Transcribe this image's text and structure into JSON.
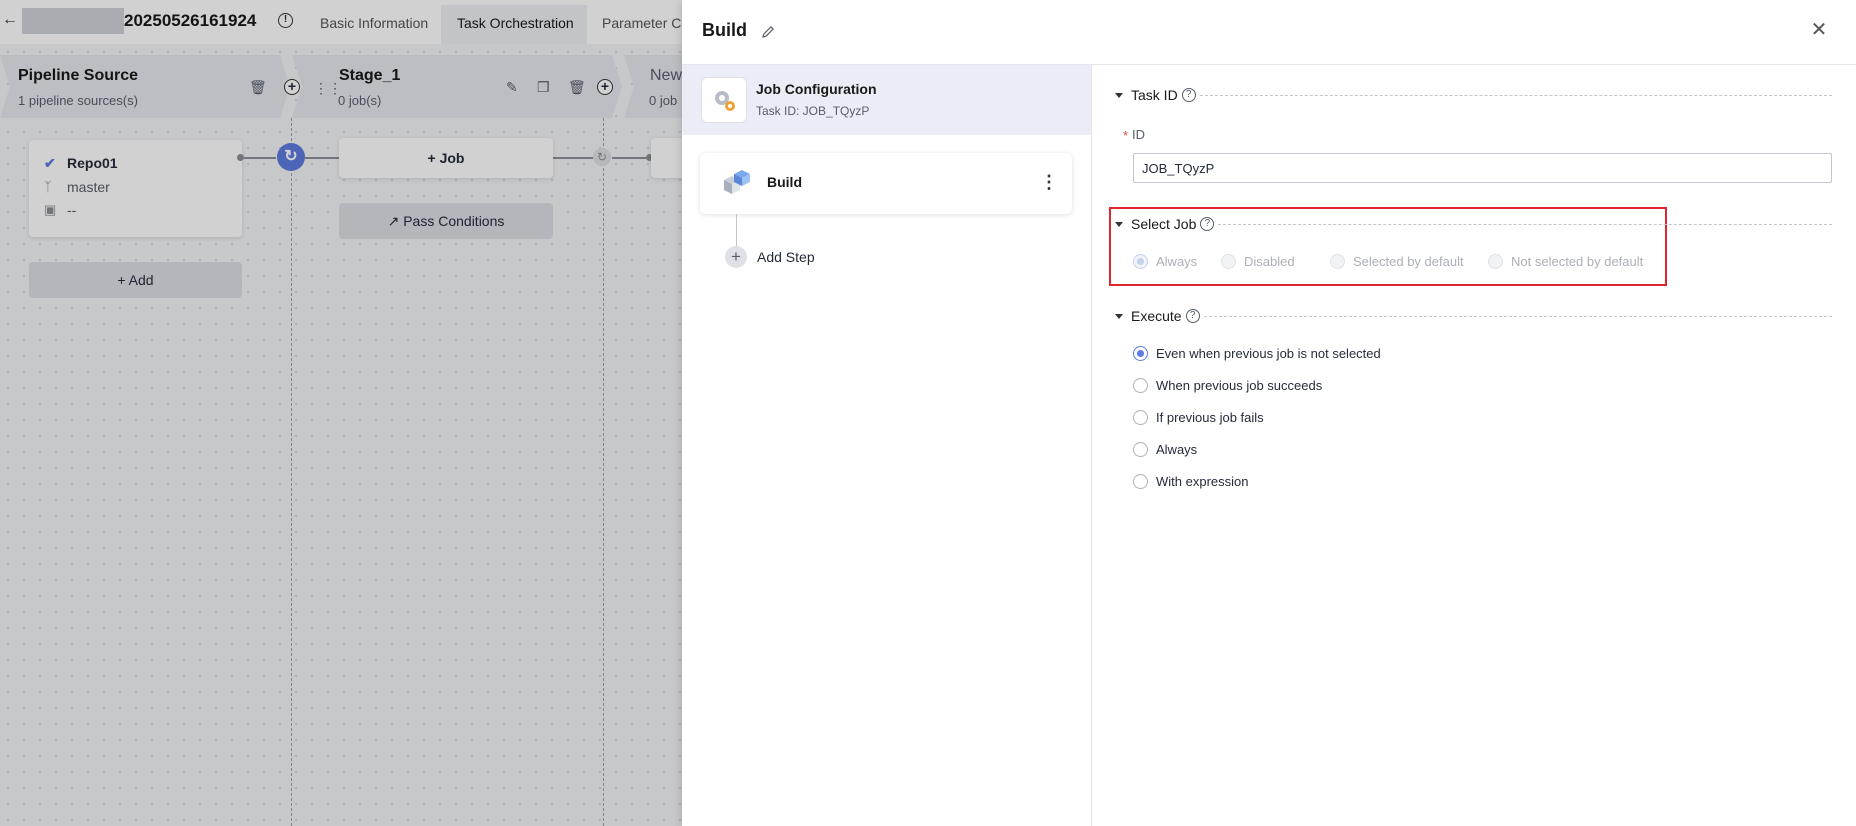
{
  "topbar": {
    "pipeline_name": "20250526161924",
    "tabs": [
      "Basic Information",
      "Task Orchestration",
      "Parameter Co"
    ],
    "active_tab": "Task Orchestration"
  },
  "pipeline": {
    "source": {
      "title": "Pipeline Source",
      "subtitle": "1 pipeline sources(s)"
    },
    "stage": {
      "title": "Stage_1",
      "subtitle": "0 job(s)"
    },
    "next_stage": {
      "title": "New",
      "subtitle": "0 job"
    },
    "repo": {
      "name": "Repo01",
      "branch": "master",
      "extra": "--"
    },
    "add_button": "+ Add",
    "job_button": "+ Job",
    "pass_conditions_button": "Pass Conditions"
  },
  "drawer": {
    "title": "Build",
    "job_config": {
      "title": "Job Configuration",
      "task_id": "Task ID: JOB_TQyzP"
    },
    "build_step": "Build",
    "add_step": "Add Step",
    "task_id_section": {
      "label": "Task ID",
      "id_label": "ID",
      "id_value": "JOB_TQyzP"
    },
    "select_job_section": {
      "label": "Select Job",
      "options": [
        "Always",
        "Disabled",
        "Selected by default",
        "Not selected by default"
      ],
      "selected": "Always",
      "disabled": true
    },
    "execute_section": {
      "label": "Execute",
      "options": [
        "Even when previous job is not selected",
        "When previous job succeeds",
        "If previous job fails",
        "Always",
        "With expression"
      ],
      "selected": "Even when previous job is not selected"
    }
  },
  "colors": {
    "accent": "#5e7ce0",
    "highlight": "#e0262b"
  }
}
